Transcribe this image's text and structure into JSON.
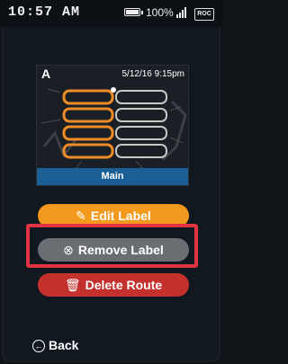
{
  "status_bar": {
    "time": "10:57 AM",
    "battery": "100%",
    "carrier_badge": "ROC"
  },
  "map_card": {
    "letter": "A",
    "datetime": "5/12/16 9:15pm",
    "label": "Main"
  },
  "actions": {
    "edit_label": "Edit Label",
    "remove_label": "Remove Label",
    "delete_route": "Delete Route"
  },
  "nav": {
    "back": "Back"
  },
  "colors": {
    "edit": "#f39a1e",
    "remove": "#6a6d71",
    "delete": "#c4302b",
    "highlight": "#e23343",
    "label_bar": "#1c5f96",
    "route_orange": "#f08c25"
  },
  "icons": {
    "edit": "pencil-icon",
    "remove": "close-circle-icon",
    "delete": "trash-icon",
    "back": "back-arrow-icon"
  }
}
